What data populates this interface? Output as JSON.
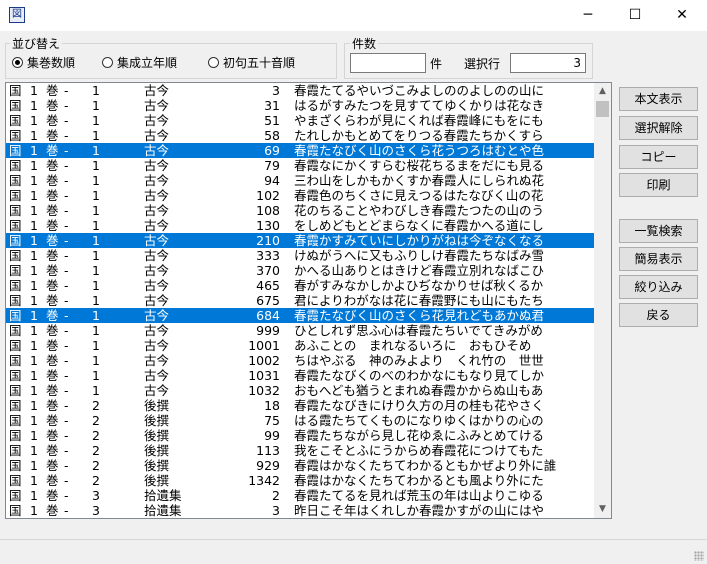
{
  "window": {
    "icon": "app-icon",
    "minimize": "─",
    "maximize": "☐",
    "close": "✕"
  },
  "sort": {
    "label": "並び替え",
    "options": [
      {
        "label": "集巻数順",
        "selected": true
      },
      {
        "label": "集成立年順",
        "selected": false
      },
      {
        "label": "初句五十音順",
        "selected": false
      }
    ]
  },
  "count": {
    "label": "件数",
    "value": "",
    "unit": "件",
    "selected_row_label": "選択行",
    "selected_row_value": "3"
  },
  "rows": [
    {
      "kuni": "国",
      "num": "1",
      "vol": "1",
      "coll": "古今",
      "no": "3",
      "text": "春霞たてるやいづこみよしののよしのの山に",
      "sel": false
    },
    {
      "kuni": "国",
      "num": "1",
      "vol": "1",
      "coll": "古今",
      "no": "31",
      "text": "はるがすみたつを見すててゆくかりは花なき",
      "sel": false
    },
    {
      "kuni": "国",
      "num": "1",
      "vol": "1",
      "coll": "古今",
      "no": "51",
      "text": "やまざくらわが見にくれば春霞峰にもをにも",
      "sel": false
    },
    {
      "kuni": "国",
      "num": "1",
      "vol": "1",
      "coll": "古今",
      "no": "58",
      "text": "たれしかもとめてをりつる春霞たちかくすら",
      "sel": false
    },
    {
      "kuni": "国",
      "num": "1",
      "vol": "1",
      "coll": "古今",
      "no": "69",
      "text": "春霞たなびく山のさくら花うつろはむとや色",
      "sel": true
    },
    {
      "kuni": "国",
      "num": "1",
      "vol": "1",
      "coll": "古今",
      "no": "79",
      "text": "春霞なにかくすらむ桜花ちるまをだにも見る",
      "sel": false
    },
    {
      "kuni": "国",
      "num": "1",
      "vol": "1",
      "coll": "古今",
      "no": "94",
      "text": "三わ山をしかもかくすか春霞人にしられぬ花",
      "sel": false
    },
    {
      "kuni": "国",
      "num": "1",
      "vol": "1",
      "coll": "古今",
      "no": "102",
      "text": "春霞色のちくさに見えつるはたなびく山の花",
      "sel": false
    },
    {
      "kuni": "国",
      "num": "1",
      "vol": "1",
      "coll": "古今",
      "no": "108",
      "text": "花のちることやわびしき春霞たつたの山のう",
      "sel": false
    },
    {
      "kuni": "国",
      "num": "1",
      "vol": "1",
      "coll": "古今",
      "no": "130",
      "text": "をしめどもとどまらなくに春霞かへる道にし",
      "sel": false
    },
    {
      "kuni": "国",
      "num": "1",
      "vol": "1",
      "coll": "古今",
      "no": "210",
      "text": "春霞かすみていにしかりがねは今ぞなくなる",
      "sel": true
    },
    {
      "kuni": "国",
      "num": "1",
      "vol": "1",
      "coll": "古今",
      "no": "333",
      "text": "けぬがうへに又もふりしけ春霞たちなばみ雪",
      "sel": false
    },
    {
      "kuni": "国",
      "num": "1",
      "vol": "1",
      "coll": "古今",
      "no": "370",
      "text": "かへる山ありとはきけど春霞立別れなばこひ",
      "sel": false
    },
    {
      "kuni": "国",
      "num": "1",
      "vol": "1",
      "coll": "古今",
      "no": "465",
      "text": "春がすみなかしかよひぢなかりせば秋くるか",
      "sel": false
    },
    {
      "kuni": "国",
      "num": "1",
      "vol": "1",
      "coll": "古今",
      "no": "675",
      "text": "君によりわがなは花に春霞野にも山にもたち",
      "sel": false
    },
    {
      "kuni": "国",
      "num": "1",
      "vol": "1",
      "coll": "古今",
      "no": "684",
      "text": "春霞たなびく山のさくら花見れどもあかぬ君",
      "sel": true
    },
    {
      "kuni": "国",
      "num": "1",
      "vol": "1",
      "coll": "古今",
      "no": "999",
      "text": "ひとしれず思ふ心は春霞たちいでてきみがめ",
      "sel": false
    },
    {
      "kuni": "国",
      "num": "1",
      "vol": "1",
      "coll": "古今",
      "no": "1001",
      "text": "あふことの　まれなるいろに　おもひそめ",
      "sel": false
    },
    {
      "kuni": "国",
      "num": "1",
      "vol": "1",
      "coll": "古今",
      "no": "1002",
      "text": "ちはやぶる　神のみよより　くれ竹の　世世",
      "sel": false
    },
    {
      "kuni": "国",
      "num": "1",
      "vol": "1",
      "coll": "古今",
      "no": "1031",
      "text": "春霞たなびくのべのわかなにもなり見てしか",
      "sel": false
    },
    {
      "kuni": "国",
      "num": "1",
      "vol": "1",
      "coll": "古今",
      "no": "1032",
      "text": "おもへども猶うとまれぬ春霞かからぬ山もあ",
      "sel": false
    },
    {
      "kuni": "国",
      "num": "1",
      "vol": "2",
      "coll": "後撰",
      "no": "18",
      "text": "春霞たなびきにけり久方の月の桂も花やさく",
      "sel": false
    },
    {
      "kuni": "国",
      "num": "1",
      "vol": "2",
      "coll": "後撰",
      "no": "75",
      "text": "はる霞たちてくものになりゆくはかりの心の",
      "sel": false
    },
    {
      "kuni": "国",
      "num": "1",
      "vol": "2",
      "coll": "後撰",
      "no": "99",
      "text": "春霞たちながら見し花ゆゑにふみとめてける",
      "sel": false
    },
    {
      "kuni": "国",
      "num": "1",
      "vol": "2",
      "coll": "後撰",
      "no": "113",
      "text": "我をこそとふにうからめ春霞花につけてもた",
      "sel": false
    },
    {
      "kuni": "国",
      "num": "1",
      "vol": "2",
      "coll": "後撰",
      "no": "929",
      "text": "春霞はかなくたちてわかるともかぜより外に誰",
      "sel": false
    },
    {
      "kuni": "国",
      "num": "1",
      "vol": "2",
      "coll": "後撰",
      "no": "1342",
      "text": "春霞はかなくたちてわかるとも風より外にた",
      "sel": false
    },
    {
      "kuni": "国",
      "num": "1",
      "vol": "3",
      "coll": "拾遺集",
      "no": "2",
      "text": "春霞たてるを見れば荒玉の年は山よりこゆる",
      "sel": false
    },
    {
      "kuni": "国",
      "num": "1",
      "vol": "3",
      "coll": "拾遺集",
      "no": "3",
      "text": "昨日こそ年はくれしか春霞かすがの山にはや",
      "sel": false
    }
  ],
  "row_common": {
    "kan": "巻",
    "dash": "-"
  },
  "buttons": {
    "body": "本文表示",
    "deselect": "選択解除",
    "copy": "コピー",
    "print": "印刷",
    "list_search": "一覧検索",
    "simple": "簡易表示",
    "narrow": "絞り込み",
    "back": "戻る"
  }
}
